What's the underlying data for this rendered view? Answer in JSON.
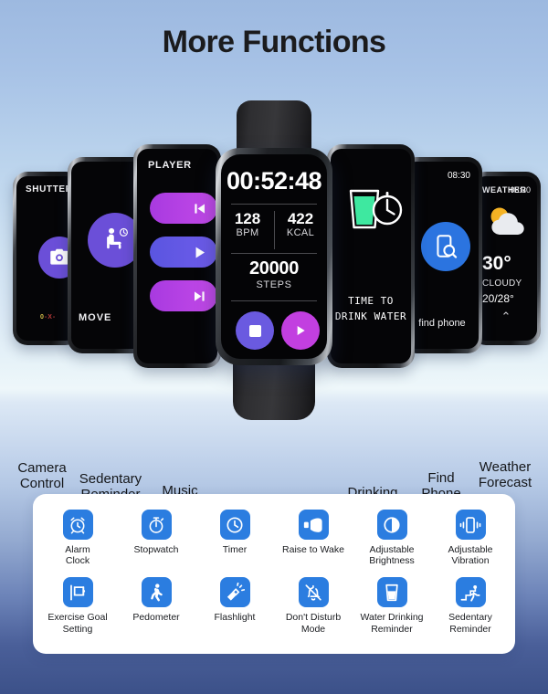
{
  "header": {
    "title": "More Functions"
  },
  "watches": {
    "camera": {
      "label": "SHUTTER",
      "icon": "camera-icon",
      "accent": "#6b4fd8",
      "indicator": "0-X-"
    },
    "sedentary": {
      "label": "MOVE",
      "icon": "sitting-person-clock-icon",
      "accent": "#6b4fd8"
    },
    "music": {
      "title": "PLAYER",
      "buttons": [
        "previous-track",
        "play",
        "next-track"
      ],
      "accents": [
        "#c44ae8",
        "#6f5cea",
        "#c44ae8"
      ]
    },
    "hero": {
      "time": "00:52:48",
      "bpm_value": "128",
      "bpm_unit": "BPM",
      "kcal_value": "422",
      "kcal_unit": "KCAL",
      "steps_value": "20000",
      "steps_unit": "STEPS",
      "stop_color": "#6a5ae0",
      "play_color": "#c23fe0"
    },
    "drink": {
      "line1": "TIME TO",
      "line2": "DRINK WATER",
      "icon": "water-glass-clock-icon",
      "glass_color": "#3ee8a0"
    },
    "find": {
      "time": "08:30",
      "label": "find phone",
      "icon": "phone-search-icon",
      "accent": "#2b74e0"
    },
    "weather": {
      "title": "WEATHER",
      "time": "08:30",
      "temp": "30°",
      "condition": "CLOUDY",
      "range": "20/28°",
      "chevron": "⌃",
      "icon": "sun-cloud-icon"
    }
  },
  "captions": {
    "camera": "Camera\nControl",
    "sedentary": "Sedentary\nReminder",
    "music": "Music\nControl",
    "drink": "Drinking\nReminder",
    "find": "Find\nPhone",
    "weather": "Weather\nForecast"
  },
  "features": {
    "tile_color": "#2b7de0",
    "items": [
      {
        "label": "Alarm\nClock",
        "icon": "alarm-clock-icon"
      },
      {
        "label": "Stopwatch",
        "icon": "stopwatch-icon"
      },
      {
        "label": "Timer",
        "icon": "timer-clock-icon"
      },
      {
        "label": "Raise to Wake",
        "icon": "raise-to-wake-icon"
      },
      {
        "label": "Adjustable\nBrightness",
        "icon": "brightness-icon"
      },
      {
        "label": "Adjustable\nVibration",
        "icon": "vibration-icon"
      },
      {
        "label": "Exercise Goal\nSetting",
        "icon": "flag-goal-icon"
      },
      {
        "label": "Pedometer",
        "icon": "walking-person-icon"
      },
      {
        "label": "Flashlight",
        "icon": "flashlight-icon"
      },
      {
        "label": "Don't Disturb\nMode",
        "icon": "bell-muted-icon"
      },
      {
        "label": "Water Drinking\nReminder",
        "icon": "water-glass-icon"
      },
      {
        "label": "Sedentary\nReminder",
        "icon": "walking-stairs-icon"
      }
    ]
  }
}
